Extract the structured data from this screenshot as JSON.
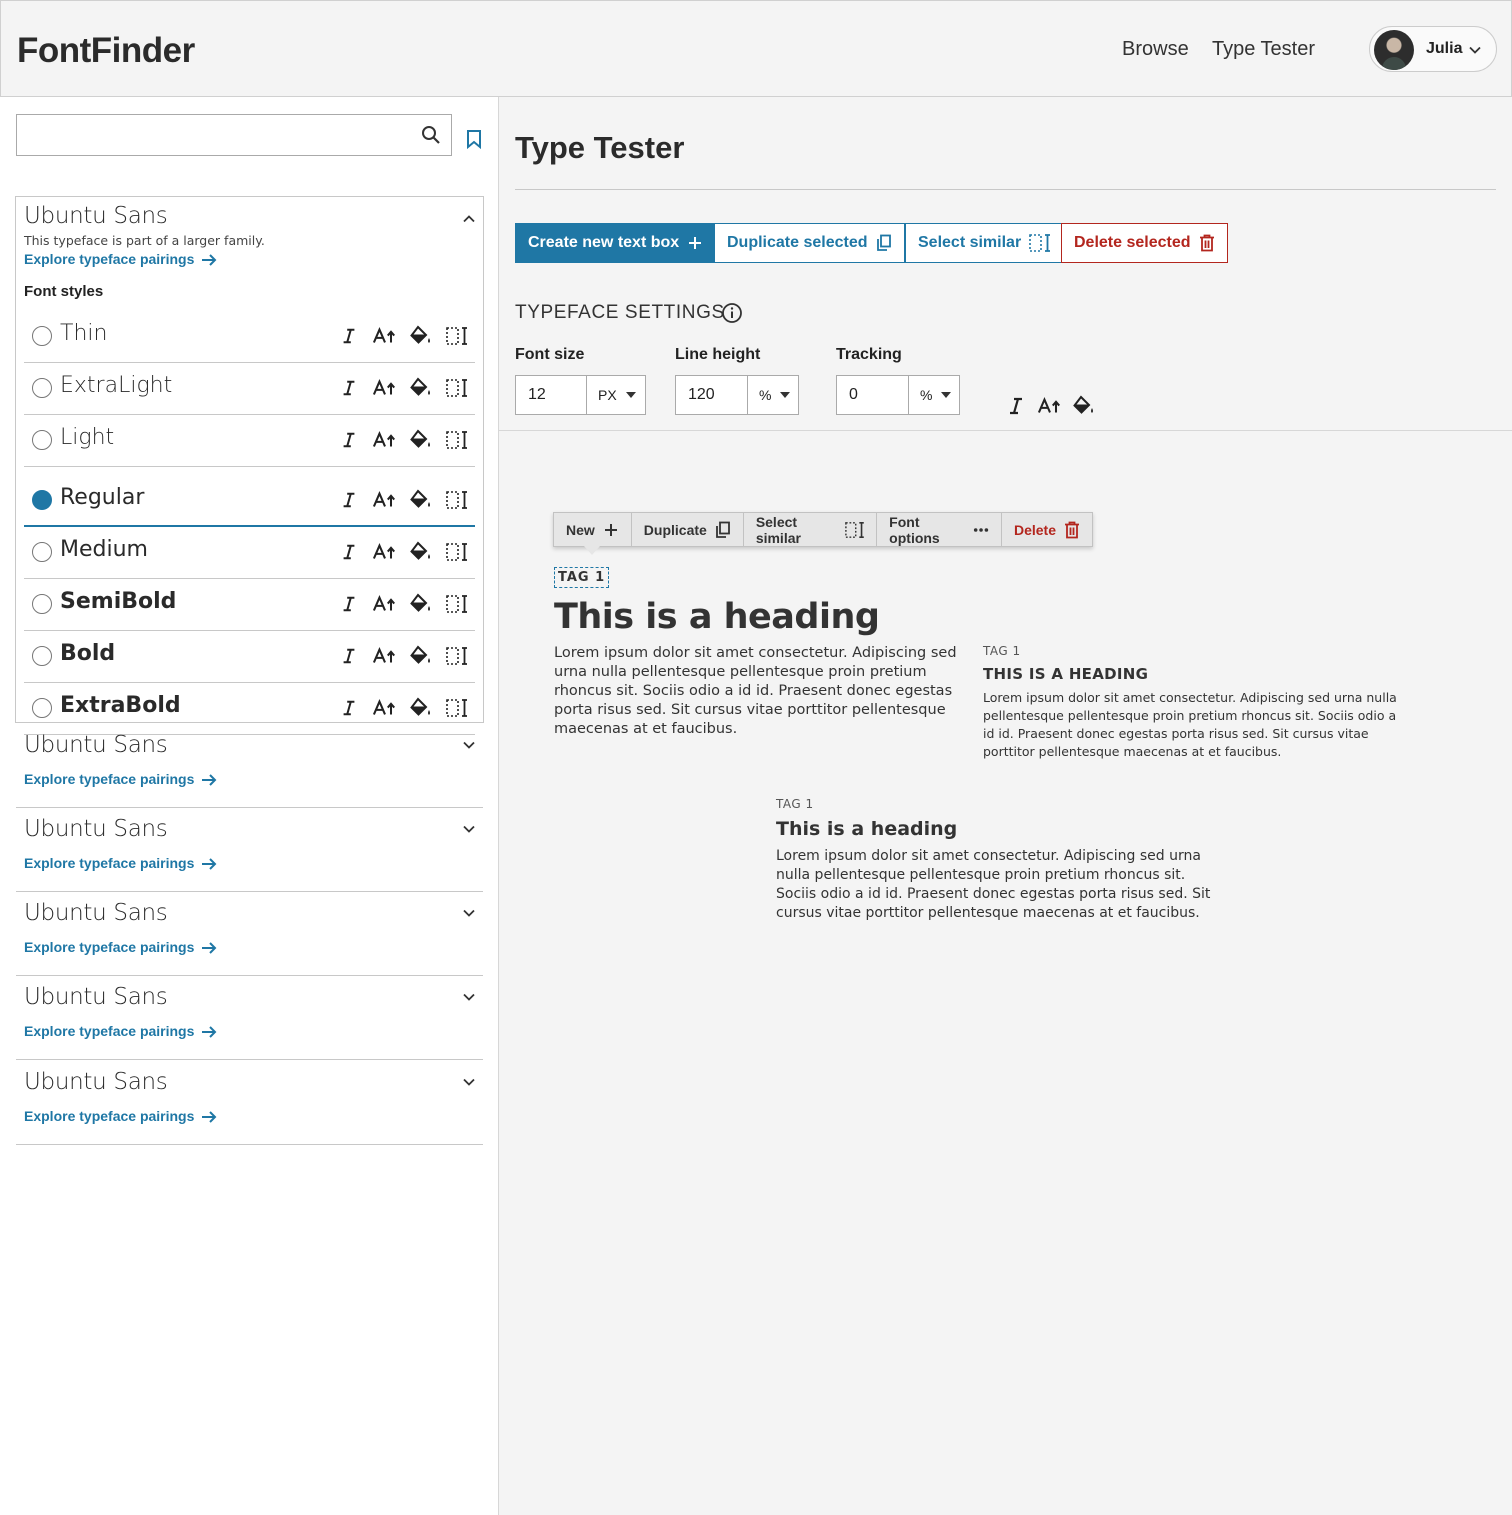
{
  "app": {
    "title": "FontFinder"
  },
  "nav": {
    "browse": "Browse",
    "type_tester": "Type Tester"
  },
  "user": {
    "name": "Julia"
  },
  "sidebar": {
    "search": {
      "value": "",
      "placeholder": ""
    },
    "expanded_family": {
      "name": "Ubuntu Sans",
      "note": "This typeface is part of a larger family.",
      "pairings_link": "Explore typeface pairings",
      "styles_title": "Font styles",
      "styles": [
        {
          "label": "Thin",
          "selected": false
        },
        {
          "label": "ExtraLight",
          "selected": false
        },
        {
          "label": "Light",
          "selected": false
        },
        {
          "label": "Regular",
          "selected": true
        },
        {
          "label": "Medium",
          "selected": false
        },
        {
          "label": "SemiBold",
          "selected": false
        },
        {
          "label": "Bold",
          "selected": false
        },
        {
          "label": "ExtraBold",
          "selected": false
        }
      ]
    },
    "families": [
      {
        "name": "Ubuntu Sans",
        "pairings_link": "Explore typeface pairings"
      },
      {
        "name": "Ubuntu Sans",
        "pairings_link": "Explore typeface pairings"
      },
      {
        "name": "Ubuntu Sans",
        "pairings_link": "Explore typeface pairings"
      },
      {
        "name": "Ubuntu Sans",
        "pairings_link": "Explore typeface pairings"
      },
      {
        "name": "Ubuntu Sans",
        "pairings_link": "Explore typeface pairings"
      }
    ]
  },
  "main": {
    "title": "Type Tester",
    "actions": {
      "create": "Create new text box",
      "duplicate": "Duplicate selected",
      "select_similar": "Select similar",
      "delete": "Delete selected"
    },
    "settings": {
      "title": "TYPEFACE SETTINGS",
      "font_size": {
        "label": "Font size",
        "value": "12",
        "unit": "PX"
      },
      "line_height": {
        "label": "Line height",
        "value": "120",
        "unit": "%"
      },
      "tracking": {
        "label": "Tracking",
        "value": "0",
        "unit": "%"
      }
    },
    "context_menu": {
      "new": "New",
      "duplicate": "Duplicate",
      "select_similar": "Select similar",
      "font_options": "Font options",
      "delete": "Delete"
    },
    "text_boxes": [
      {
        "tag": "TAG 1",
        "heading": "This is a heading",
        "body": "Lorem ipsum dolor sit amet consectetur. Adipiscing sed urna nulla pellentesque pellentesque proin pretium rhoncus sit. Sociis odio a id id. Praesent donec egestas porta risus sed. Sit cursus vitae porttitor pellentesque maecenas at et faucibus."
      },
      {
        "tag": "TAG 1",
        "heading": "THIS IS A HEADING",
        "body": "Lorem ipsum dolor sit amet consectetur. Adipiscing sed urna nulla pellentesque pellentesque proin pretium rhoncus sit. Sociis odio a id id. Praesent donec egestas porta risus sed. Sit cursus vitae porttitor pellentesque maecenas at et faucibus."
      },
      {
        "tag": "TAG 1",
        "heading": "This is a heading",
        "body": "Lorem ipsum dolor sit amet consectetur. Adipiscing sed urna nulla pellentesque pellentesque proin pretium rhoncus sit. Sociis odio a id id. Praesent donec egestas porta risus sed. Sit cursus vitae porttitor pellentesque maecenas at et faucibus."
      }
    ]
  },
  "colors": {
    "accent": "#1f77a5",
    "danger": "#b3261e",
    "text": "#2b2b2b",
    "surface": "#f4f4f4"
  },
  "icons": [
    "search-icon",
    "bookmark-icon",
    "chevron-up-icon",
    "chevron-down-icon",
    "arrow-right-icon",
    "italic-icon",
    "text-size-icon",
    "paint-bucket-icon",
    "select-text-icon",
    "plus-icon",
    "copy-icon",
    "trash-icon",
    "info-icon",
    "more-icon",
    "caret-down-icon"
  ]
}
